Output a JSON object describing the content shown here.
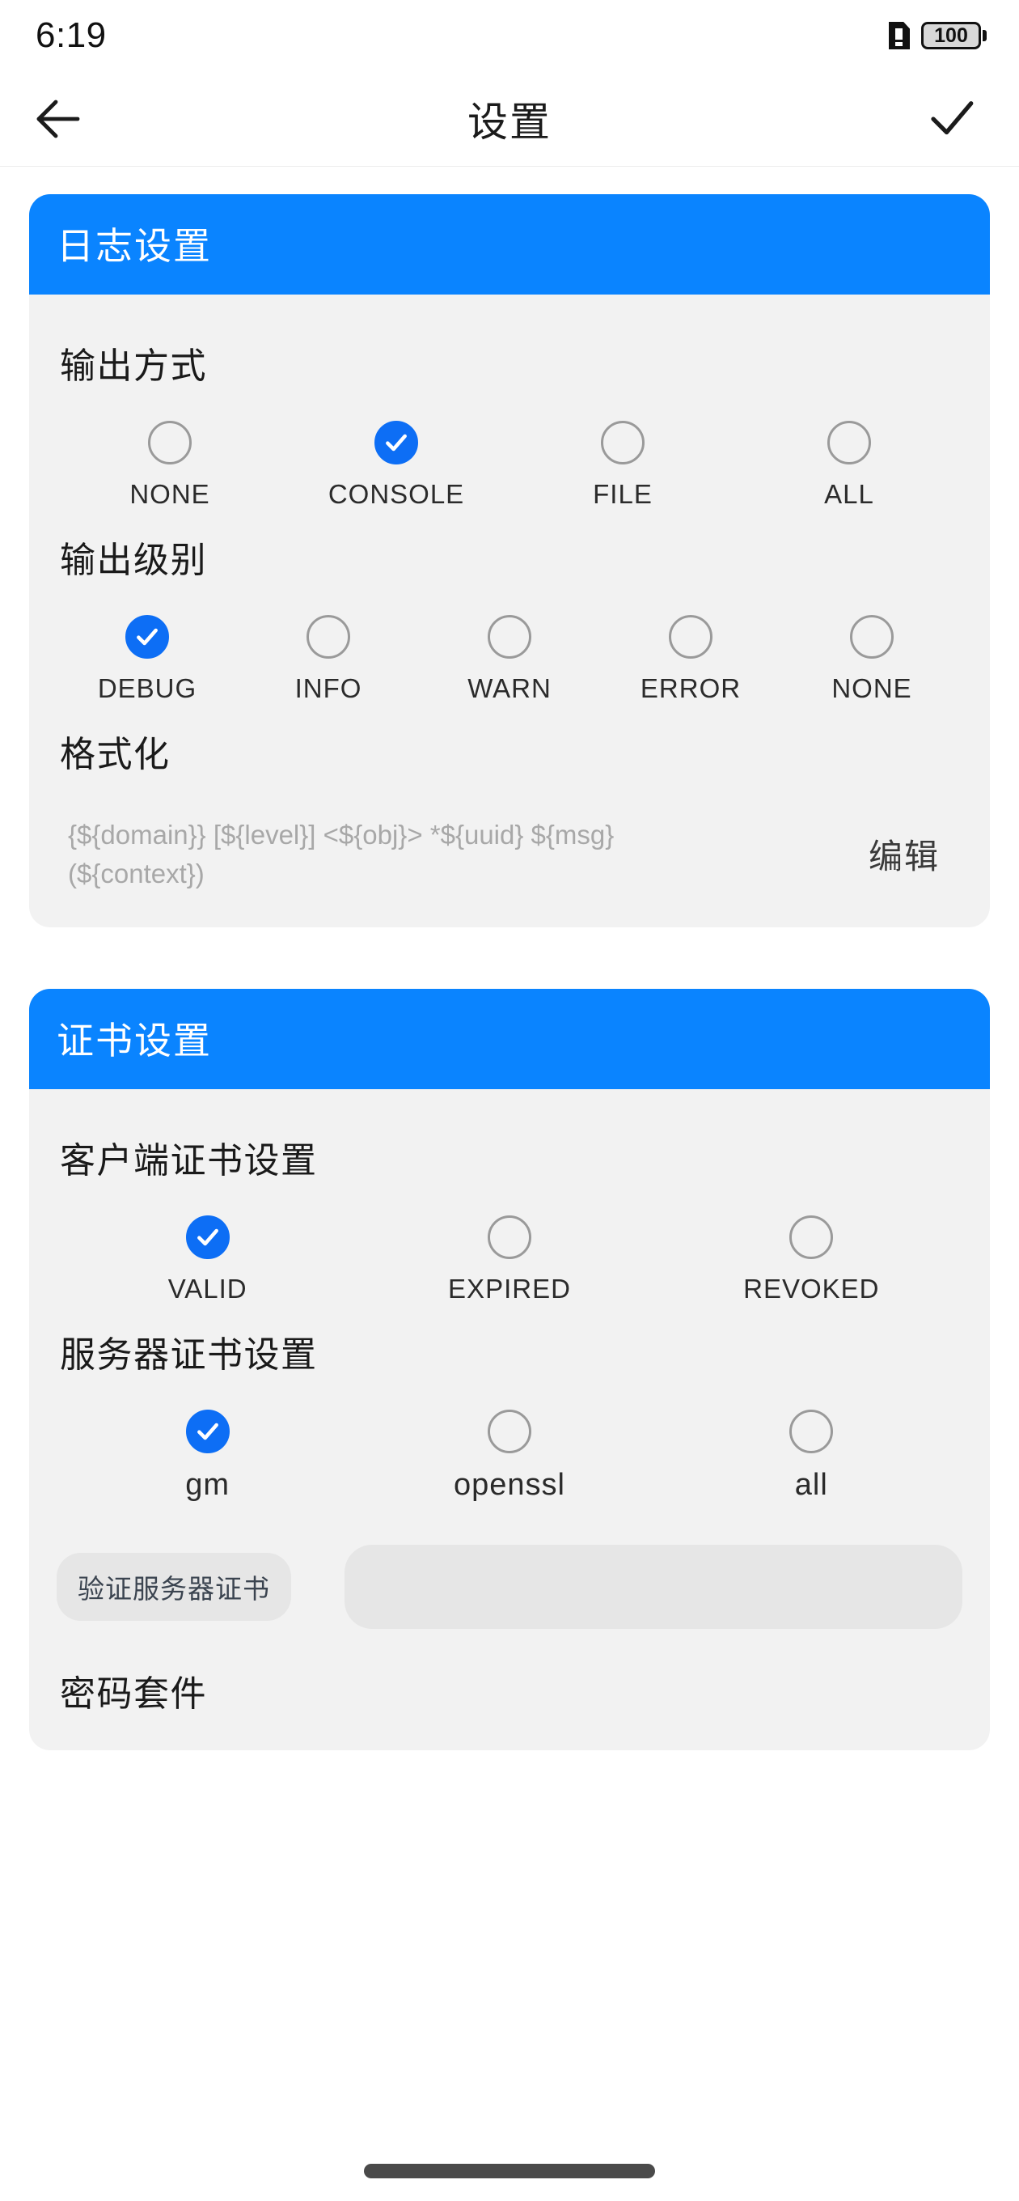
{
  "status_bar": {
    "time": "6:19",
    "battery_percent": "100",
    "sim_icon": "sim-card-icon"
  },
  "app_bar": {
    "back_icon": "arrow-left-icon",
    "title": "设置",
    "confirm_icon": "check-icon"
  },
  "colors": {
    "accent": "#0A84FF",
    "selected_radio": "#0D6EF5",
    "card_background": "#F2F2F2",
    "page_background": "#FFFFFF",
    "chip_background": "#E6E6E6",
    "muted_text": "#A8A8A8"
  },
  "cards": [
    {
      "title": "日志设置",
      "sections": [
        {
          "label": "输出方式",
          "type": "radio",
          "label_size": "upper",
          "options": [
            {
              "label": "NONE",
              "selected": false
            },
            {
              "label": "CONSOLE",
              "selected": true
            },
            {
              "label": "FILE",
              "selected": false
            },
            {
              "label": "ALL",
              "selected": false
            }
          ]
        },
        {
          "label": "输出级别",
          "type": "radio",
          "label_size": "upper",
          "options": [
            {
              "label": "DEBUG",
              "selected": true
            },
            {
              "label": "INFO",
              "selected": false
            },
            {
              "label": "WARN",
              "selected": false
            },
            {
              "label": "ERROR",
              "selected": false
            },
            {
              "label": "NONE",
              "selected": false
            }
          ]
        },
        {
          "label": "格式化",
          "type": "format",
          "value": "{${domain}} [${level}] <${obj}> *${uuid} ${msg} (${context})",
          "edit_label": "编辑"
        }
      ]
    },
    {
      "title": "证书设置",
      "sections": [
        {
          "label": "客户端证书设置",
          "type": "radio",
          "label_size": "upper",
          "options": [
            {
              "label": "VALID",
              "selected": true
            },
            {
              "label": "EXPIRED",
              "selected": false
            },
            {
              "label": "REVOKED",
              "selected": false
            }
          ]
        },
        {
          "label": "服务器证书设置",
          "type": "radio",
          "label_size": "lower",
          "options": [
            {
              "label": "gm",
              "selected": true
            },
            {
              "label": "openssl",
              "selected": false
            },
            {
              "label": "all",
              "selected": false
            }
          ]
        },
        {
          "label": "",
          "type": "chip_field",
          "chip_label": "验证服务器证书",
          "field_value": "",
          "field_placeholder": ""
        },
        {
          "label": "密码套件",
          "type": "label_only"
        }
      ]
    }
  ]
}
